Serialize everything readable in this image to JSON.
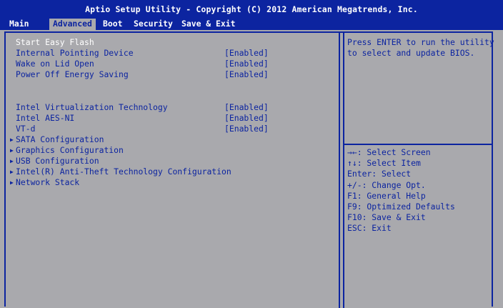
{
  "title": "Aptio Setup Utility - Copyright (C) 2012 American Megatrends, Inc.",
  "tabs": [
    {
      "label": "Main"
    },
    {
      "label": "Advanced",
      "active": true
    },
    {
      "label": "Boot"
    },
    {
      "label": "Security"
    },
    {
      "label": "Save & Exit"
    }
  ],
  "settings": [
    {
      "label": "Start Easy Flash",
      "value": "",
      "selected": true
    },
    {
      "label": "Internal Pointing Device",
      "value": "[Enabled]"
    },
    {
      "label": "Wake on Lid Open",
      "value": "[Enabled]"
    },
    {
      "label": "Power Off Energy Saving",
      "value": "[Enabled]"
    },
    {
      "label": "Intel Virtualization Technology",
      "value": "[Enabled]"
    },
    {
      "label": "Intel AES-NI",
      "value": "[Enabled]"
    },
    {
      "label": "VT-d",
      "value": "[Enabled]"
    }
  ],
  "submenus": [
    {
      "label": "SATA Configuration"
    },
    {
      "label": "Graphics Configuration"
    },
    {
      "label": "USB Configuration"
    },
    {
      "label": "Intel(R) Anti-Theft Technology Configuration"
    },
    {
      "label": "Network Stack"
    }
  ],
  "help": {
    "lines": [
      "Press ENTER to run the utility",
      "to select and update BIOS."
    ]
  },
  "keys": [
    "→←: Select Screen",
    "↑↓: Select Item",
    "Enter: Select",
    "+/-: Change Opt.",
    "F1: General Help",
    "F9: Optimized Defaults",
    "F10: Save & Exit",
    "ESC: Exit"
  ],
  "submenu_arrow": "▶",
  "colors": {
    "accent": "#0c24a0",
    "background": "#a9a9ad",
    "highlight_text": "#ffffff"
  }
}
